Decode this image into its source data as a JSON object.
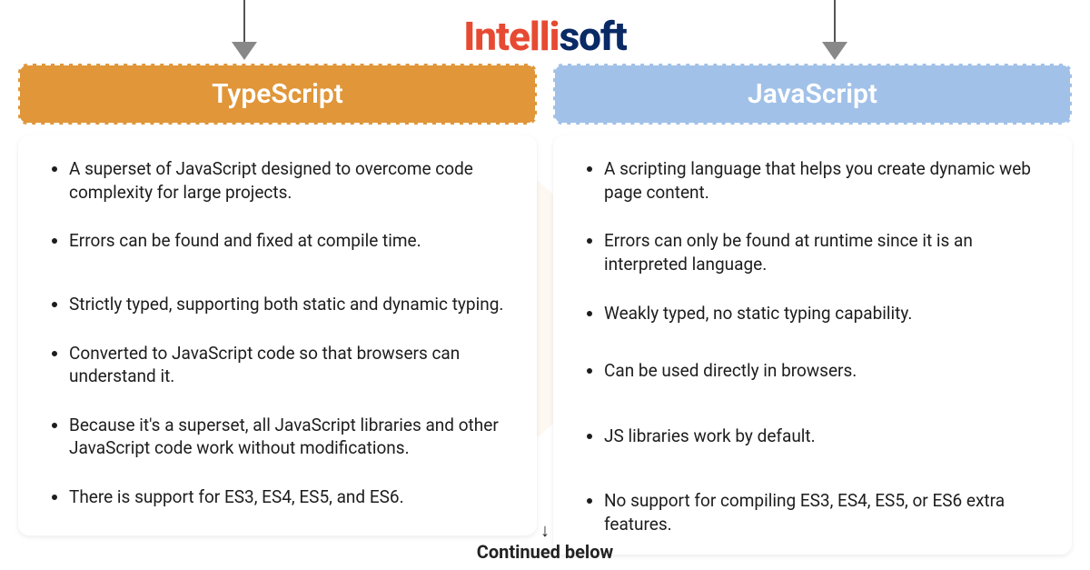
{
  "brand": {
    "part1": "Intelli",
    "part2": "soft"
  },
  "columns": {
    "ts": {
      "title": "TypeScript",
      "items": [
        "A superset of JavaScript designed to overcome code complexity for large projects.",
        "Errors can be found and fixed at compile time.",
        "Strictly typed, supporting both static and dynamic typing.",
        "Converted to JavaScript code so that browsers can understand it.",
        "Because it's a superset, all JavaScript libraries and other JavaScript code work without modifications.",
        "There is support for ES3, ES4, ES5, and ES6."
      ]
    },
    "js": {
      "title": "JavaScript",
      "items": [
        "A scripting language that helps you create dynamic web page content.",
        "Errors can only be found at runtime since it is an interpreted language.",
        "Weakly typed, no static typing capability.",
        "Can be used directly in browsers.",
        "JS libraries work by default.",
        "No support for compiling ES3, ES4, ES5, or ES6 extra features."
      ]
    }
  },
  "footer": {
    "arrow": "↓",
    "text": "Continued below"
  },
  "colors": {
    "ts_header": "#e09639",
    "js_header": "#a1c1e8",
    "brand_red": "#e74a33",
    "brand_navy": "#0a2a66"
  }
}
